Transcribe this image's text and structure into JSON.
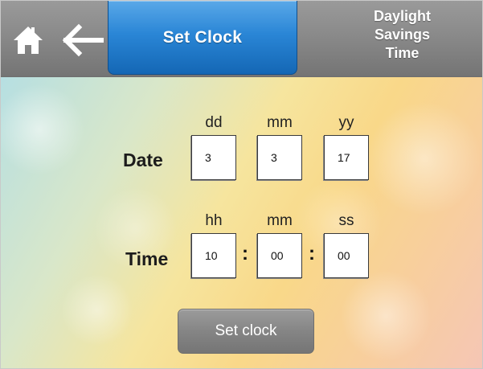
{
  "header": {
    "active_tab": "Set Clock",
    "dst_tab_lines": [
      "Daylight",
      "Savings",
      "Time"
    ]
  },
  "date": {
    "label": "Date",
    "columns": [
      "dd",
      "mm",
      "yy"
    ],
    "values": [
      "3",
      "3",
      "17"
    ]
  },
  "time": {
    "label": "Time",
    "columns": [
      "hh",
      "mm",
      "ss"
    ],
    "values": [
      "10",
      "00",
      "00"
    ],
    "separator": ":"
  },
  "set_button_label": "Set clock",
  "colors": {
    "header_gray": "#8a8a8a",
    "tab_blue": "#2a86d6",
    "button_gray": "#858585"
  },
  "icons": [
    "home-icon",
    "arrow-left-icon"
  ]
}
